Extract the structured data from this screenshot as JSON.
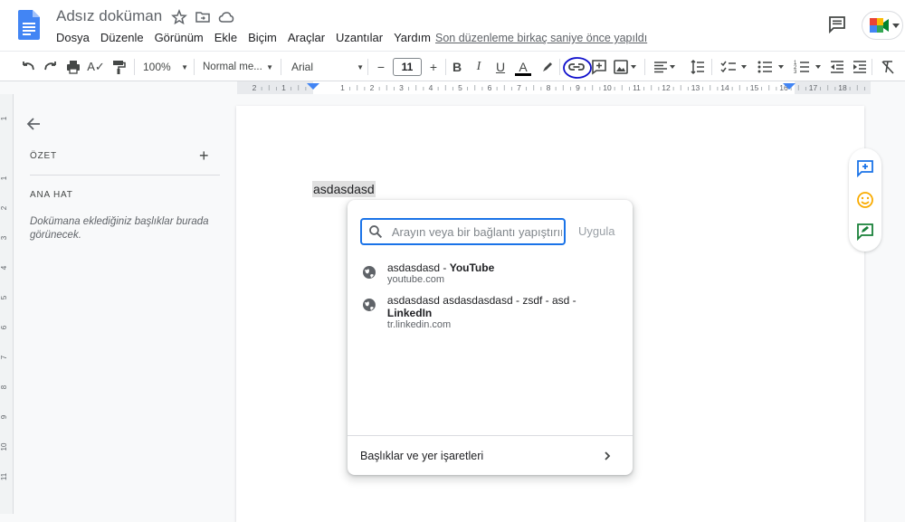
{
  "document": {
    "title": "Adsız doküman",
    "last_edit": "Son düzenleme birkaç saniye önce yapıldı",
    "selected_text": "asdasdasd"
  },
  "menubar": [
    "Dosya",
    "Düzenle",
    "Görünüm",
    "Ekle",
    "Biçim",
    "Araçlar",
    "Uzantılar",
    "Yardım"
  ],
  "toolbar": {
    "zoom": "100%",
    "style": "Normal me...",
    "font": "Arial",
    "font_size": "11",
    "minus": "−",
    "plus": "+",
    "bold": "B",
    "italic": "I",
    "underline": "U",
    "text_color": "A"
  },
  "ruler_ticks": [
    "2",
    "1",
    "1",
    "2",
    "3",
    "4",
    "5",
    "6",
    "7",
    "8",
    "9",
    "10",
    "11",
    "12",
    "13",
    "14",
    "15",
    "16",
    "17",
    "18"
  ],
  "vruler_ticks": [
    "2",
    "1",
    "1",
    "2",
    "3",
    "4",
    "5",
    "6",
    "7",
    "8",
    "9",
    "10",
    "11"
  ],
  "outline": {
    "summary_label": "ÖZET",
    "add_symbol": "+",
    "outline_label": "ANA HAT",
    "empty_hint": "Dokümana eklediğiniz başlıklar burada görünecek."
  },
  "link_popup": {
    "placeholder": "Arayın veya bir bağlantı yapıştırın",
    "apply_label": "Uygula",
    "suggestions": [
      {
        "title_normal": "asdasdasd - ",
        "title_bold": "YouTube",
        "url": "youtube.com"
      },
      {
        "title_normal": "asdasdasd asdasdasdasd - zsdf - asd - ",
        "title_bold": "LinkedIn",
        "url": "tr.linkedin.com"
      }
    ],
    "bookmarks_label": "Başlıklar ve yer işaretleri"
  },
  "colors": {
    "accent": "#1a73e8",
    "docs_blue": "#4285f4",
    "annotation_circle": "#1010cc",
    "side_icon_blue": "#1a73e8",
    "side_icon_yellow": "#f9ab00",
    "side_icon_green": "#188038"
  },
  "icons": {
    "docs_logo": "docs-logo-icon",
    "star": "star-icon",
    "move": "move-to-folder-icon",
    "cloud": "cloud-status-icon",
    "comments": "comment-history-icon",
    "meet": "meet-icon",
    "link": "insert-link-icon",
    "search": "search-icon",
    "globe": "globe-icon"
  }
}
